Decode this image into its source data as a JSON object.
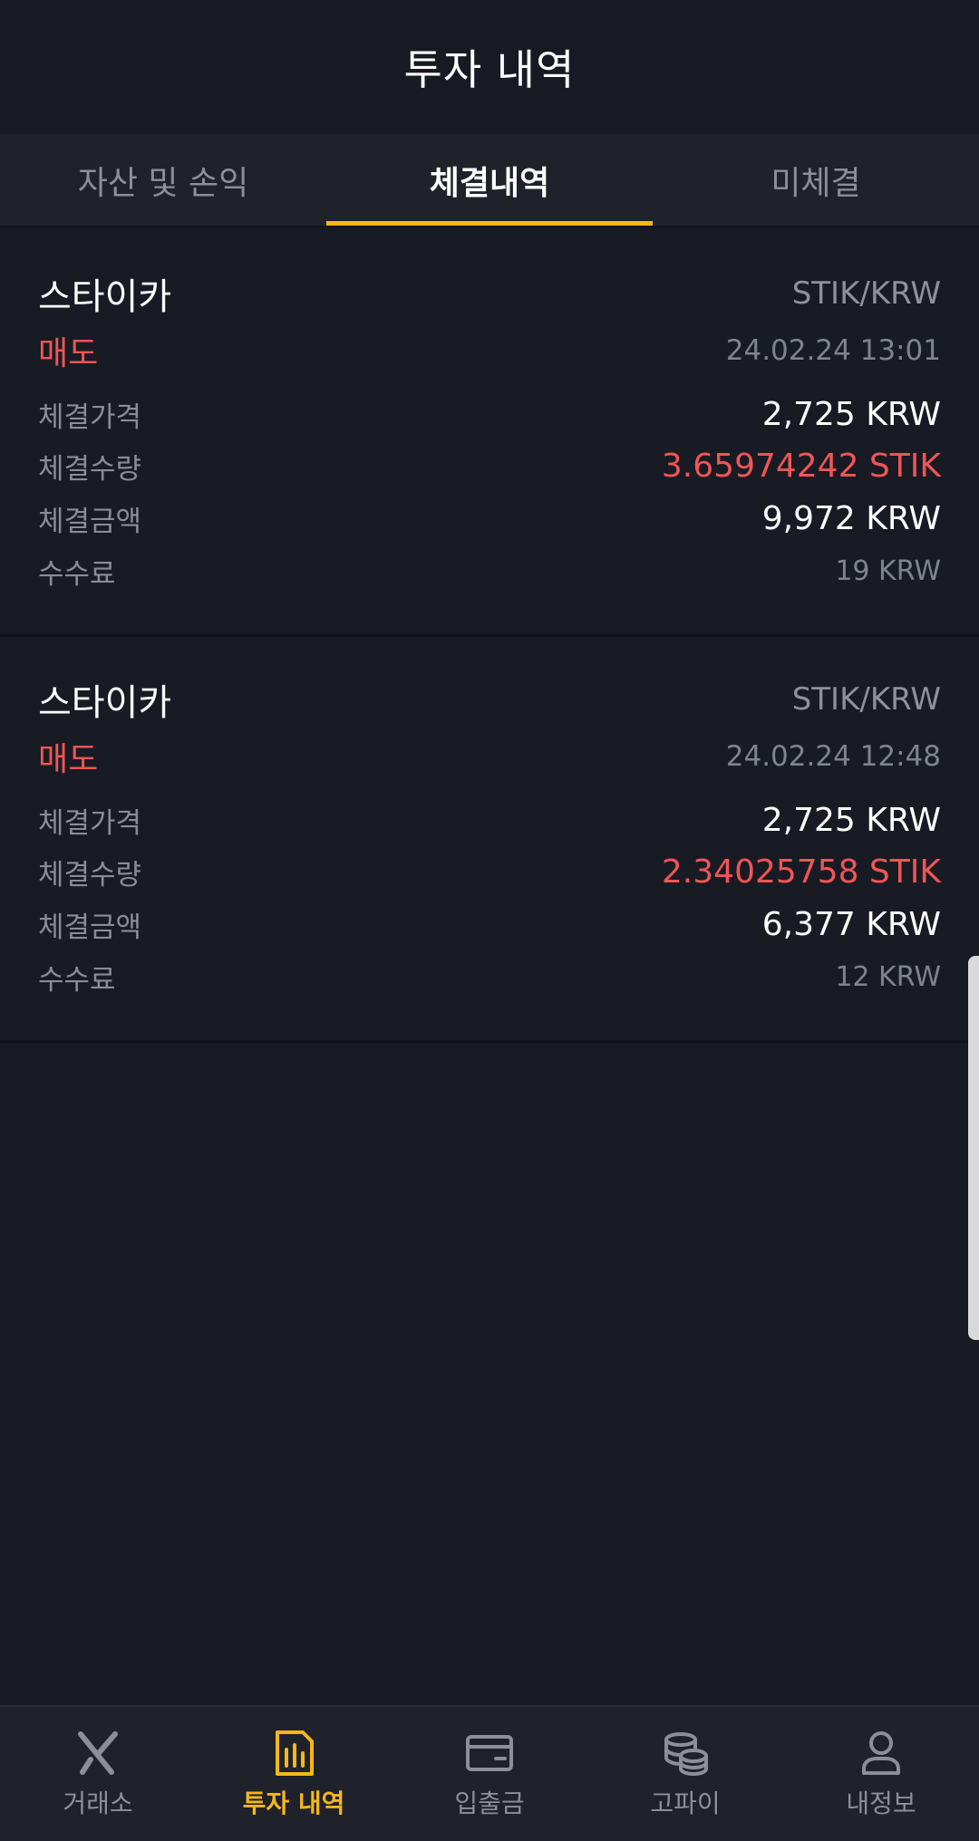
{
  "header": {
    "title": "투자 내역"
  },
  "tabs": [
    {
      "label": "자산 및 손익",
      "active": false
    },
    {
      "label": "체결내역",
      "active": true
    },
    {
      "label": "미체결",
      "active": false
    }
  ],
  "trades": [
    {
      "coin": "스타이카",
      "pair": "STIK/KRW",
      "side": "매도",
      "datetime": "24.02.24 13:01",
      "price_label": "체결가격",
      "price": "2,725 KRW",
      "qty_label": "체결수량",
      "qty": "3.65974242 STIK",
      "amount_label": "체결금액",
      "amount": "9,972 KRW",
      "fee_label": "수수료",
      "fee": "19 KRW"
    },
    {
      "coin": "스타이카",
      "pair": "STIK/KRW",
      "side": "매도",
      "datetime": "24.02.24 12:48",
      "price_label": "체결가격",
      "price": "2,725 KRW",
      "qty_label": "체결수량",
      "qty": "2.34025758 STIK",
      "amount_label": "체결금액",
      "amount": "6,377 KRW",
      "fee_label": "수수료",
      "fee": "12 KRW"
    }
  ],
  "bottom_nav": [
    {
      "label": "거래소",
      "icon": "exchange-x-icon",
      "active": false
    },
    {
      "label": "투자 내역",
      "icon": "report-icon",
      "active": true
    },
    {
      "label": "입출금",
      "icon": "wallet-icon",
      "active": false
    },
    {
      "label": "고파이",
      "icon": "coins-icon",
      "active": false
    },
    {
      "label": "내정보",
      "icon": "user-icon",
      "active": false
    }
  ],
  "colors": {
    "background": "#181b23",
    "accent": "#f5b719",
    "sell": "#f05555",
    "muted": "#8c8f97"
  }
}
